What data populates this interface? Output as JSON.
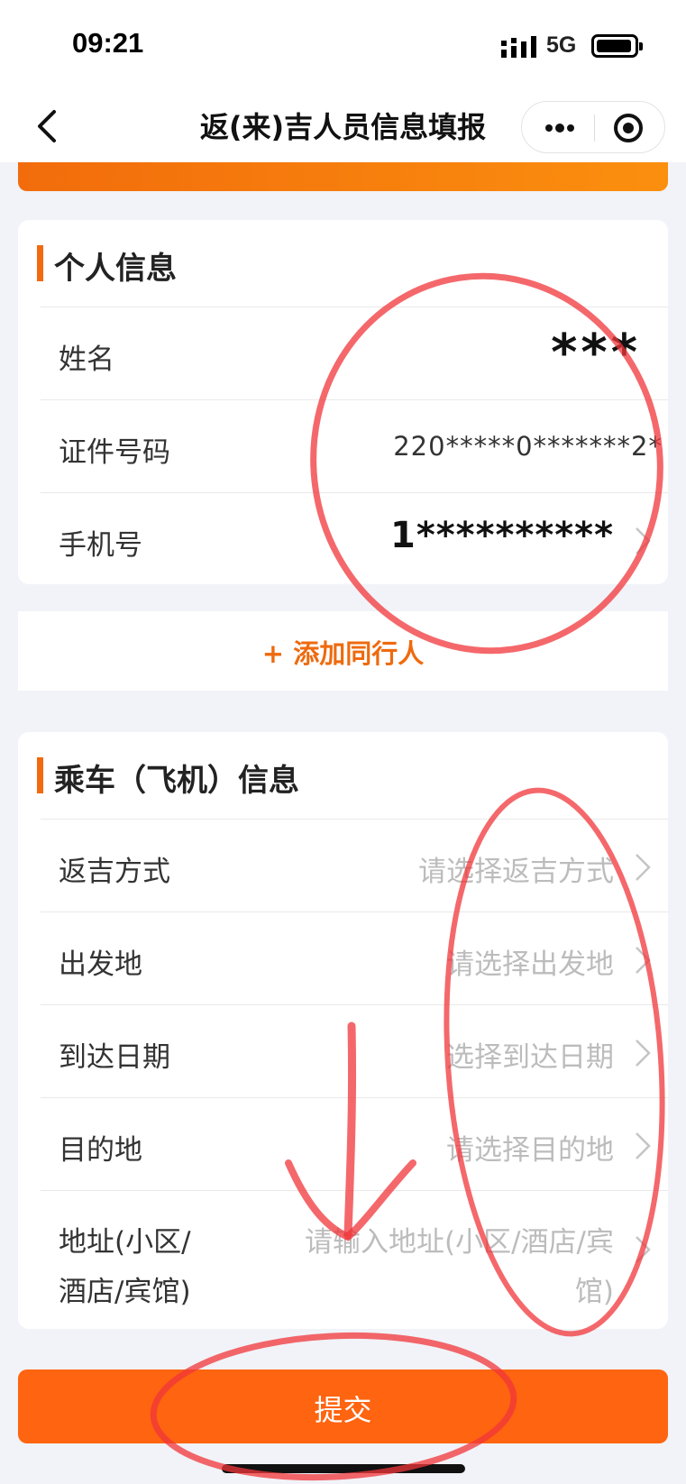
{
  "status": {
    "time": "09:21",
    "network": "5G"
  },
  "nav": {
    "title": "返(来)吉人员信息填报"
  },
  "personal": {
    "title": "个人信息",
    "rows": [
      {
        "label": "姓名",
        "value": "***"
      },
      {
        "label": "证件号码",
        "value": "220*****0*******2*"
      },
      {
        "label": "手机号",
        "value": "1**********"
      }
    ]
  },
  "add_companion": "+ 添加同行人",
  "trip": {
    "title": "乘车（飞机）信息",
    "rows": [
      {
        "label": "返吉方式",
        "placeholder": "请选择返吉方式"
      },
      {
        "label": "出发地",
        "placeholder": "请选择出发地"
      },
      {
        "label": "到达日期",
        "placeholder": "选择到达日期"
      },
      {
        "label": "目的地",
        "placeholder": "请选择目的地"
      }
    ],
    "address": {
      "label_line1": "地址(小区/",
      "label_line2": "酒店/宾馆)",
      "placeholder_line1": "请输入地址(小区/酒店/宾",
      "placeholder_line2": "馆)"
    }
  },
  "submit_label": "提交",
  "colors": {
    "accent": "#ff6410",
    "annotation": "#f0353a"
  }
}
